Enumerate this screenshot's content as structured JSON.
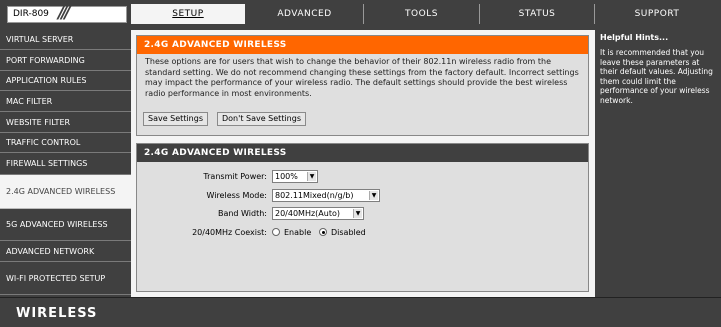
{
  "header": {
    "model": "DIR-809",
    "slashes": "///",
    "tabs": [
      {
        "label": "SETUP",
        "active": true
      },
      {
        "label": "ADVANCED",
        "active": false
      },
      {
        "label": "TOOLS",
        "active": false
      },
      {
        "label": "STATUS",
        "active": false
      },
      {
        "label": "SUPPORT",
        "active": false
      }
    ]
  },
  "sidebar": {
    "items": [
      {
        "label": "VIRTUAL SERVER",
        "active": false
      },
      {
        "label": "PORT FORWARDING",
        "active": false
      },
      {
        "label": "APPLICATION RULES",
        "active": false
      },
      {
        "label": "MAC FILTER",
        "active": false
      },
      {
        "label": "WEBSITE FILTER",
        "active": false
      },
      {
        "label": "TRAFFIC CONTROL",
        "active": false
      },
      {
        "label": "FIREWALL SETTINGS",
        "active": false
      },
      {
        "label": "2.4G ADVANCED WIRELESS",
        "active": true
      },
      {
        "label": "5G ADVANCED WIRELESS",
        "active": false
      },
      {
        "label": "ADVANCED NETWORK",
        "active": false
      },
      {
        "label": "WI-FI PROTECTED SETUP",
        "active": false
      }
    ]
  },
  "intro_panel": {
    "title": "2.4G ADVANCED WIRELESS",
    "text": "These options are for users that wish to change the behavior of their 802.11n wireless radio from the standard setting. We do not recommend changing these settings from the factory default. Incorrect settings may impact the performance of your wireless radio. The default settings should provide the best wireless radio performance in most environments.",
    "save_label": "Save Settings",
    "dont_save_label": "Don't Save Settings"
  },
  "settings_panel": {
    "title": "2.4G ADVANCED WIRELESS",
    "transmit_power": {
      "label": "Transmit Power:",
      "value": "100%"
    },
    "wireless_mode": {
      "label": "Wireless Mode:",
      "value": "802.11Mixed(n/g/b)"
    },
    "band_width": {
      "label": "Band Width:",
      "value": "20/40MHz(Auto)"
    },
    "coexist": {
      "label": "20/40MHz Coexist:",
      "enable_label": "Enable",
      "disabled_label": "Disabled",
      "selected": "Disabled"
    }
  },
  "hints": {
    "title": "Helpful Hints...",
    "text": "It is recommended that you leave these parameters at their default values. Adjusting them could limit the performance of your wireless network."
  },
  "footer": {
    "brand": "WIRELESS"
  },
  "colors": {
    "accent": "#ff6600",
    "dark": "#404040"
  }
}
